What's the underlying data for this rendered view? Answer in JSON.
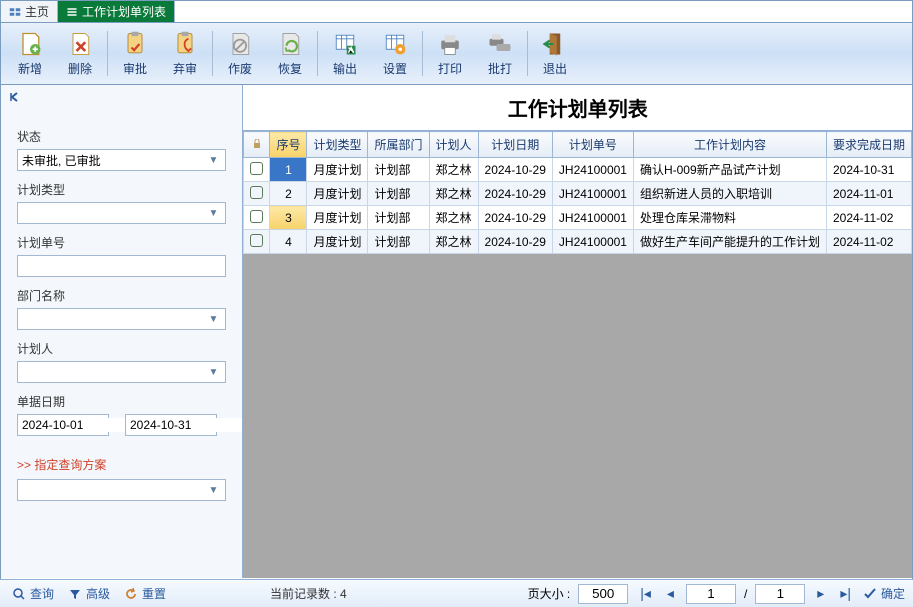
{
  "tabs": {
    "home": "主页",
    "list": "工作计划单列表"
  },
  "toolbar": {
    "add": "新增",
    "del": "删除",
    "approve": "审批",
    "abandon": "弃审",
    "void": "作废",
    "restore": "恢复",
    "export": "输出",
    "settings": "设置",
    "print": "打印",
    "batchprint": "批打",
    "exit": "退出"
  },
  "title": "工作计划单列表",
  "filters": {
    "status_label": "状态",
    "status_value": "未审批, 已审批",
    "plan_type_label": "计划类型",
    "plan_no_label": "计划单号",
    "dept_label": "部门名称",
    "planner_label": "计划人",
    "date_label": "单据日期",
    "date_from": "2024-10-01",
    "date_sep": "-",
    "date_to": "2024-10-31",
    "scheme_label": ">>  指定查询方案"
  },
  "actions": {
    "query": "查询",
    "advanced": "高级",
    "reset": "重置"
  },
  "columns": {
    "lock": "",
    "idx": "序号",
    "plan_type": "计划类型",
    "dept": "所属部门",
    "planner": "计划人",
    "plan_date": "计划日期",
    "plan_no": "计划单号",
    "content": "工作计划内容",
    "due_date": "要求完成日期"
  },
  "rows": [
    {
      "idx": "1",
      "plan_type": "月度计划",
      "dept": "计划部",
      "planner": "郑之林",
      "plan_date": "2024-10-29",
      "plan_no": "JH24100001",
      "content": "确认H-009新产品试产计划",
      "due_date": "2024-10-31"
    },
    {
      "idx": "2",
      "plan_type": "月度计划",
      "dept": "计划部",
      "planner": "郑之林",
      "plan_date": "2024-10-29",
      "plan_no": "JH24100001",
      "content": "组织新进人员的入职培训",
      "due_date": "2024-11-01"
    },
    {
      "idx": "3",
      "plan_type": "月度计划",
      "dept": "计划部",
      "planner": "郑之林",
      "plan_date": "2024-10-29",
      "plan_no": "JH24100001",
      "content": "处理仓库呆滞物料",
      "due_date": "2024-11-02"
    },
    {
      "idx": "4",
      "plan_type": "月度计划",
      "dept": "计划部",
      "planner": "郑之林",
      "plan_date": "2024-10-29",
      "plan_no": "JH24100001",
      "content": "做好生产车间产能提升的工作计划",
      "due_date": "2024-11-02"
    }
  ],
  "footer": {
    "record_label": "当前记录数 :",
    "record_count": "4",
    "pagesize_label": "页大小 :",
    "pagesize": "500",
    "page": "1",
    "page_sep": "/",
    "page_total": "1",
    "confirm": "确定"
  }
}
